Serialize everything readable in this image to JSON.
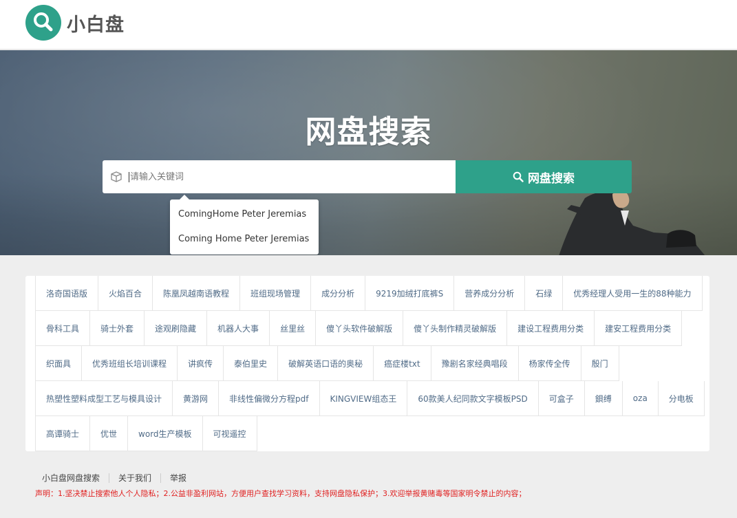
{
  "site": {
    "name": "小白盘"
  },
  "hero": {
    "title": "网盘搜索",
    "search_placeholder": "请输入关键词",
    "search_button": "网盘搜索",
    "suggestions": [
      "ComingHome Peter Jeremias",
      "Coming Home Peter Jeremias"
    ]
  },
  "tags": [
    [
      "洛奇国语版",
      "火焰百合",
      "陈凰凤越南语教程",
      "班组现场管理",
      "成分分析",
      "9219加绒打底裤S",
      "营养成分分析",
      "石绿",
      "优秀经理人受用一生的88种能力"
    ],
    [
      "骨科工具",
      "骑士外套",
      "途观刷隐藏",
      "机器人大事",
      "丝里丝",
      "傻丫头软件破解版",
      "傻丫头制作精灵破解版",
      "建设工程费用分类",
      "建安工程费用分类"
    ],
    [
      "织面具",
      "优秀班组长培训课程",
      "讲疯传",
      "泰伯里史",
      "破解英语口语的奥秘",
      "癌症楼txt",
      "豫剧名家经典唱段",
      "杨家传全传",
      "殷门"
    ],
    [
      "热塑性塑料成型工艺与模具设计",
      "黄游网",
      "非线性偏微分方程pdf",
      "KINGVIEW组态王",
      "60款美人纪同款文字模板PSD",
      "可盒子",
      "鋇缚",
      "oza",
      "分电板"
    ],
    [
      "高谭骑士",
      "优世",
      "word生产模板",
      "可视遥控"
    ]
  ],
  "footer": {
    "links": [
      "小白盘网盘搜索",
      "关于我们",
      "举报"
    ],
    "notice": "声明：1.坚决禁止搜索他人个人隐私；2.公益非盈利网站，方便用户查找学习资料，支持网盘隐私保护；3.欢迎举报黄赌毒等国家明令禁止的内容；"
  },
  "colors": {
    "accent": "#2ea18a",
    "tag_text": "#506b87",
    "notice": "#e02020"
  },
  "icons": {
    "logo": "search-icon",
    "input": "cube-icon",
    "button": "search-icon"
  }
}
